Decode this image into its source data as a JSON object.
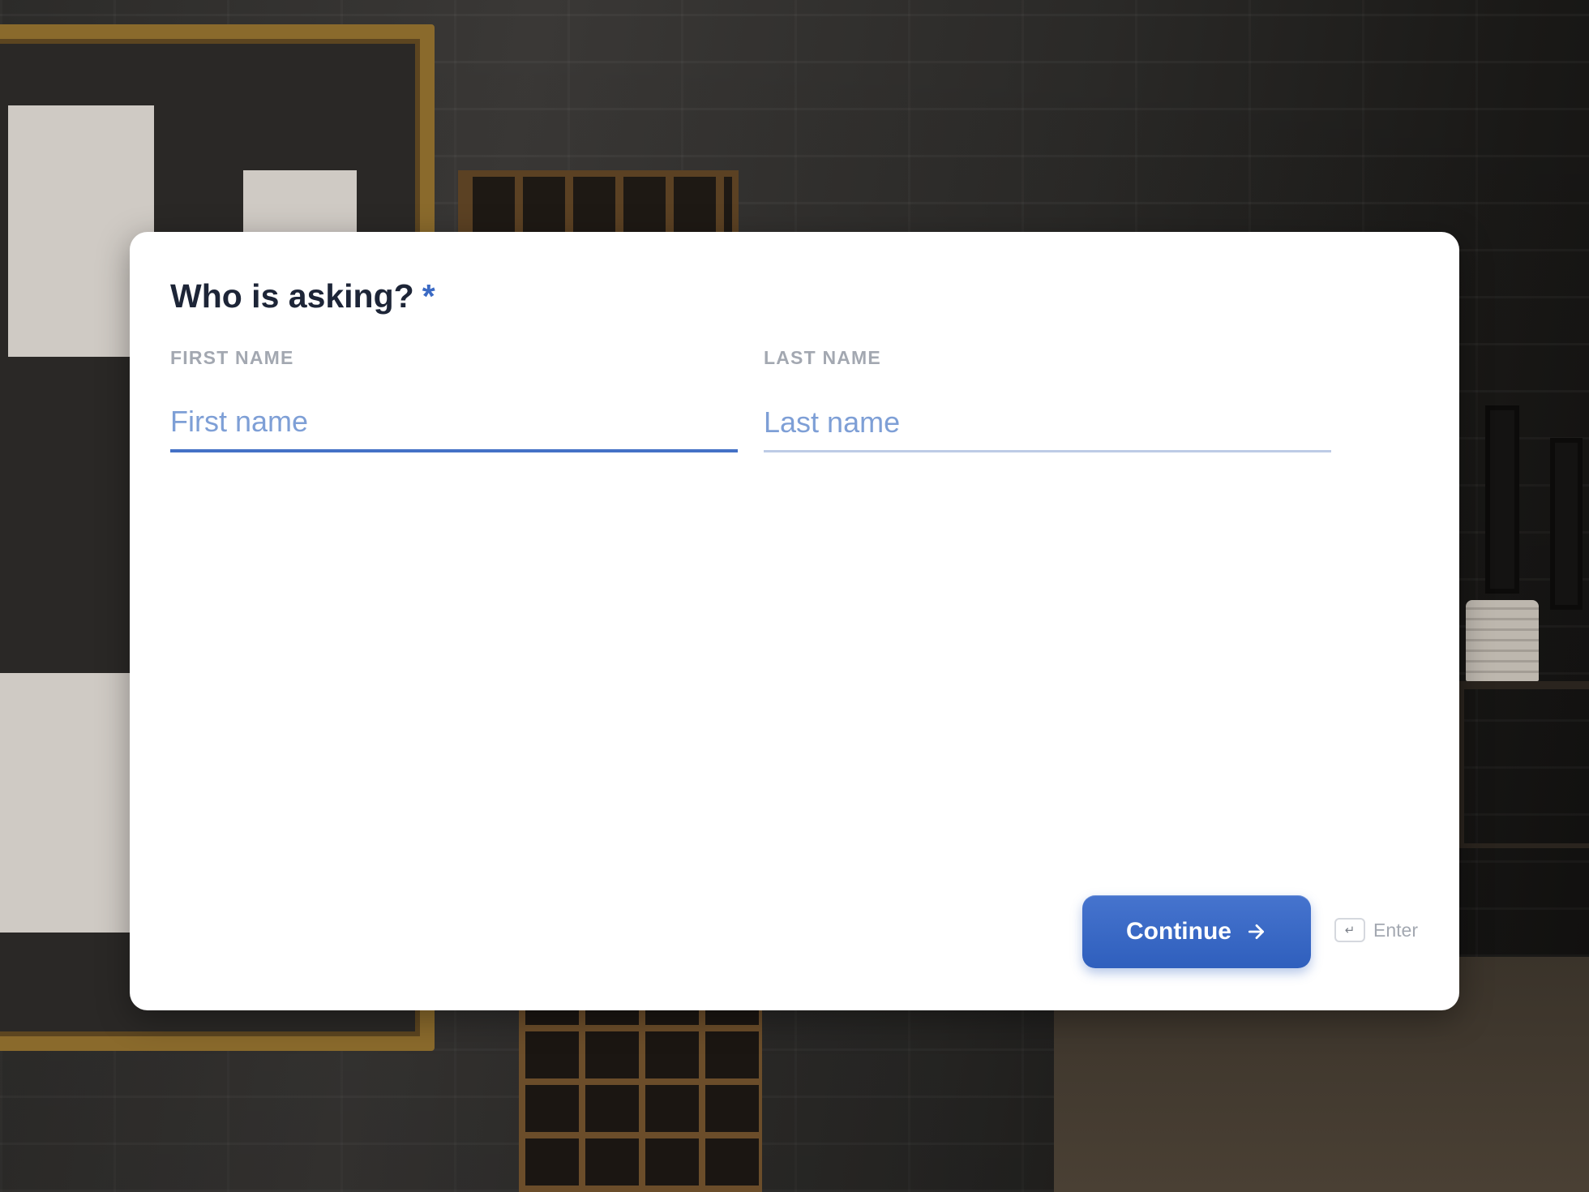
{
  "question": {
    "title": "Who is asking?",
    "required_marker": "*"
  },
  "fields": {
    "first_name": {
      "label": "FIRST NAME",
      "placeholder": "First name",
      "value": ""
    },
    "last_name": {
      "label": "LAST NAME",
      "placeholder": "Last name",
      "value": ""
    }
  },
  "actions": {
    "continue_label": "Continue",
    "continue_icon": "arrow-right-icon",
    "enter_key_glyph": "↵",
    "enter_hint": "Enter"
  },
  "colors": {
    "accent": "#3b6ac4",
    "heading": "#1d2537",
    "label": "#a3a8b1",
    "placeholder": "#7e9fd6"
  }
}
